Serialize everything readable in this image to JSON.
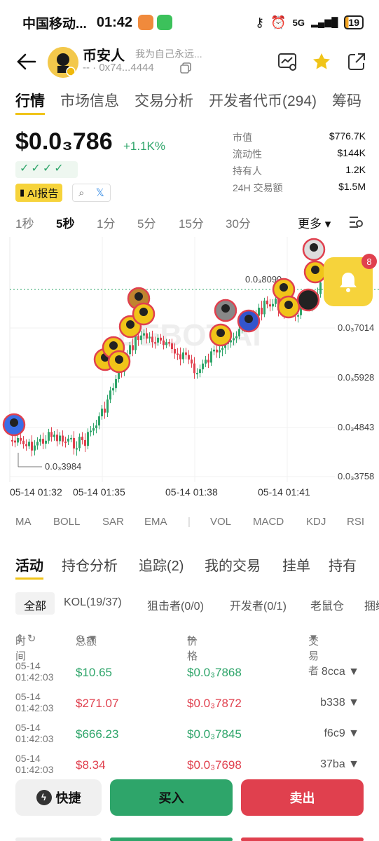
{
  "status": {
    "carrier": "中国移动...",
    "time": "01:42",
    "net": "5G",
    "battery": "19"
  },
  "header": {
    "title": "币安人",
    "description": "我为自己永远...",
    "subtitle": "-- · 0x74...4444"
  },
  "main_tabs": [
    "行情",
    "市场信息",
    "交易分析",
    "开发者代币(294)",
    "筹码"
  ],
  "price": {
    "value": "$0.0₃786",
    "change": "+1.1K%",
    "checks": "✓✓✓✓",
    "ai_label": "AI报告"
  },
  "stats": [
    {
      "label": "市值",
      "value": "$776.7K"
    },
    {
      "label": "流动性",
      "value": "$144K"
    },
    {
      "label": "持有人",
      "value": "1.2K"
    },
    {
      "label": "24H 交易额",
      "value": "$1.5M"
    }
  ],
  "intervals": [
    "1秒",
    "5秒",
    "1分",
    "5分",
    "15分",
    "30分"
  ],
  "intervals_active": "5秒",
  "more_label": "更多",
  "chart_data": {
    "type": "candlestick",
    "watermark": "DEBOT.AI",
    "y_axis_labels": [
      "0.0₃7014",
      "0.0₃5928",
      "0.0₃4843",
      "0.0₃3758"
    ],
    "high_label": "0.0₃8099",
    "low_label": "0.0₃3984",
    "x_axis_labels": [
      "05-14 01:32",
      "05-14 01:35",
      "05-14 01:38",
      "05-14 01:41"
    ]
  },
  "bell_badge": "8",
  "indicators": [
    "MA",
    "BOLL",
    "SAR",
    "EMA",
    "VOL",
    "MACD",
    "KDJ",
    "RSI"
  ],
  "activity_tabs": [
    "活动",
    "持仓分析",
    "追踪(2)",
    "我的交易",
    "挂单",
    "持有"
  ],
  "filters": [
    "全部",
    "KOL(19/37)",
    "狙击者(0/0)",
    "开发者(0/1)",
    "老鼠仓",
    "捆绑"
  ],
  "table_header": {
    "time": "时间",
    "amount": "总额",
    "price": "价格",
    "trader": "交易者"
  },
  "trades": [
    {
      "date": "05-14",
      "time": "01:42:03",
      "amount": "$10.65",
      "price": "$0.0₃7868",
      "trader": "8cca",
      "side": "buy"
    },
    {
      "date": "05-14",
      "time": "01:42:03",
      "amount": "$271.07",
      "price": "$0.0₃7872",
      "trader": "b338",
      "side": "sell"
    },
    {
      "date": "05-14",
      "time": "01:42:03",
      "amount": "$666.23",
      "price": "$0.0₃7845",
      "trader": "f6c9",
      "side": "buy"
    },
    {
      "date": "05-14",
      "time": "01:42:03",
      "amount": "$8.34",
      "price": "$0.0₃7698",
      "trader": "37ba",
      "side": "sell"
    }
  ],
  "actions": {
    "quick": "快捷",
    "buy": "买入",
    "sell": "卖出"
  },
  "colors": {
    "up": "#2ea56a",
    "down": "#e0404e",
    "accent": "#f6d33b"
  }
}
